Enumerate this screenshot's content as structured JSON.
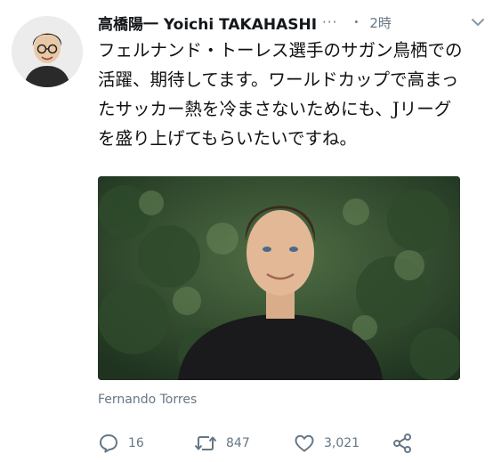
{
  "tweet": {
    "author_name": "高橋陽一 Yoichi TAKAHASHI",
    "more_icon": "ellipsis-icon",
    "separator": "・",
    "timestamp": "2時",
    "text": "フェルナンド・トーレス選手のサガン鳥栖での活躍、期待してます。ワールドカップで高まったサッカー熱を冷まさないためにも、Jリーグを盛り上げてもらいたいですね。",
    "media_caption": "Fernando Torres",
    "stats": {
      "replies": "16",
      "retweets": "847",
      "likes": "3,021"
    }
  },
  "icons": {
    "reply": "reply-icon",
    "retweet": "retweet-icon",
    "like": "heart-icon",
    "share": "share-icon",
    "chevron": "chevron-down-icon"
  },
  "colors": {
    "muted": "#657786",
    "text": "#14171a"
  }
}
